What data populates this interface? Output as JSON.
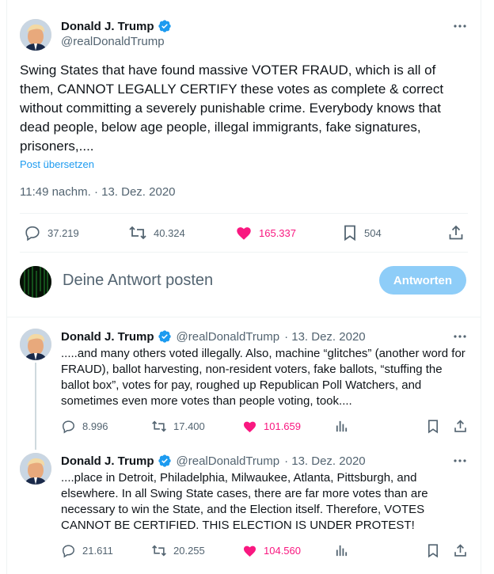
{
  "main_tweet": {
    "author_name": "Donald J. Trump",
    "handle": "@realDonaldTrump",
    "text": "Swing States that have found massive VOTER FRAUD, which is all of them, CANNOT LEGALLY CERTIFY these votes as complete & correct without committing a severely punishable crime. Everybody knows that dead people, below age people, illegal immigrants, fake signatures, prisoners,....",
    "translate_label": "Post übersetzen",
    "timestamp": "11:49 nachm. · 13. Dez. 2020",
    "stats": {
      "replies": "37.219",
      "retweets": "40.324",
      "likes": "165.337",
      "bookmarks": "504"
    }
  },
  "reply_box": {
    "placeholder": "Deine Antwort posten",
    "button_label": "Antworten"
  },
  "thread": [
    {
      "author_name": "Donald J. Trump",
      "handle": "@realDonaldTrump",
      "date": "· 13. Dez. 2020",
      "text": ".....and many others voted illegally. Also, machine “glitches” (another word for FRAUD), ballot harvesting, non-resident voters, fake ballots, “stuffing the ballot box”, votes for pay, roughed up Republican Poll Watchers, and sometimes even more votes than people voting, took....",
      "stats": {
        "replies": "8.996",
        "retweets": "17.400",
        "likes": "101.659"
      }
    },
    {
      "author_name": "Donald J. Trump",
      "handle": "@realDonaldTrump",
      "date": "· 13. Dez. 2020",
      "text": "....place in Detroit, Philadelphia, Milwaukee, Atlanta, Pittsburgh, and elsewhere. In all Swing State cases, there are far more votes than are necessary to win the State, and the Election itself. Therefore, VOTES CANNOT BE CERTIFIED. THIS ELECTION IS UNDER PROTEST!",
      "stats": {
        "replies": "21.611",
        "retweets": "20.255",
        "likes": "104.560"
      }
    }
  ],
  "colors": {
    "accent": "#1d9bf0",
    "like": "#f91880",
    "muted": "#536471",
    "button_disabled": "#8ecdf8"
  },
  "icons": [
    "verified-badge-icon",
    "more-icon",
    "reply-icon",
    "retweet-icon",
    "heart-icon",
    "bookmark-icon",
    "share-icon",
    "analytics-icon"
  ]
}
